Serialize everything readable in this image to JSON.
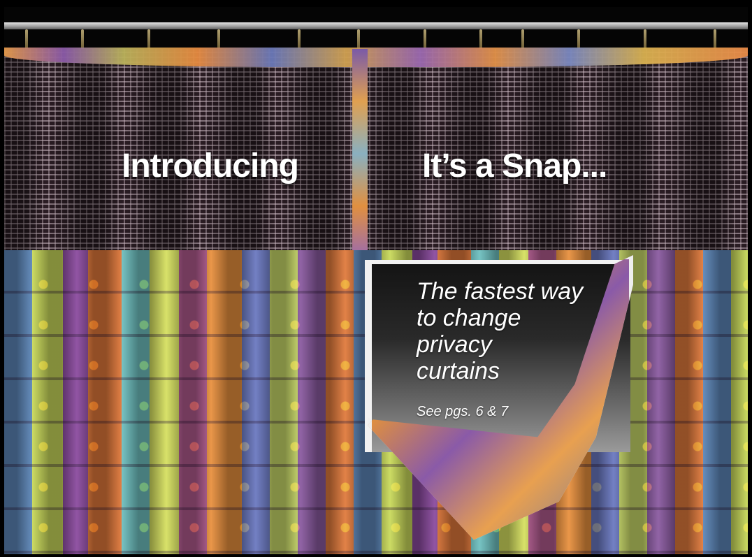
{
  "headline": {
    "left": "Introducing",
    "right": "It’s a Snap..."
  },
  "panel": {
    "tagline_lines": [
      "The fastest way",
      "to change",
      "privacy",
      "curtains"
    ],
    "page_reference": "See pgs. 6 & 7"
  },
  "colors": {
    "background": "#000000",
    "text": "#ffffff",
    "mesh": "#2b1d24",
    "fabric_accent_orange": "#e0783a",
    "fabric_accent_purple": "#8a4a9e",
    "fabric_accent_lime": "#c9d95a",
    "fabric_accent_blue": "#5c86b8"
  }
}
